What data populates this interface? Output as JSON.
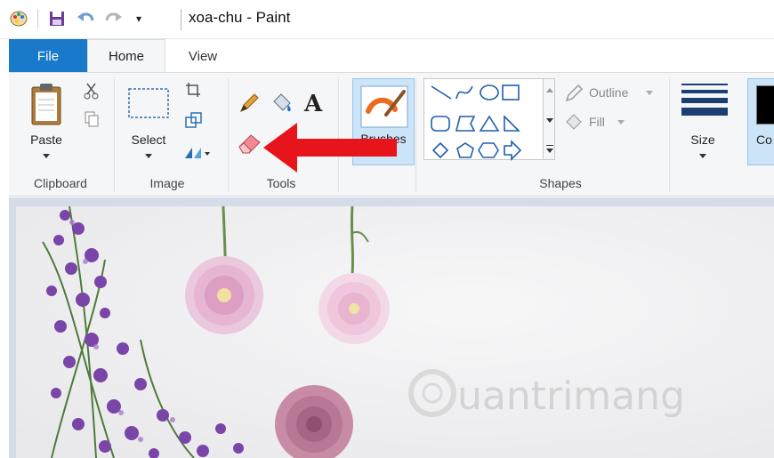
{
  "window": {
    "title": "xoa-chu - Paint"
  },
  "quick_access": {
    "customize_glyph": "▾"
  },
  "tabs": {
    "file": "File",
    "home": "Home",
    "view": "View"
  },
  "ribbon": {
    "clipboard": {
      "group_label": "Clipboard",
      "paste_label": "Paste"
    },
    "image": {
      "group_label": "Image",
      "select_label": "Select"
    },
    "tools": {
      "group_label": "Tools",
      "text_glyph": "A"
    },
    "brushes": {
      "label": "Brushes"
    },
    "shapes": {
      "group_label": "Shapes",
      "outline_label": "Outline",
      "fill_label": "Fill"
    },
    "size": {
      "label": "Size"
    },
    "colors": {
      "color1_label": "Co"
    }
  },
  "annotation": {
    "arrow_color": "#e8141b"
  },
  "watermark": {
    "text": "uantrimang"
  },
  "colors": {
    "accent": "#1979ca",
    "ribbon_bg": "#f5f6f7",
    "selected_bg": "#cce4f7"
  }
}
